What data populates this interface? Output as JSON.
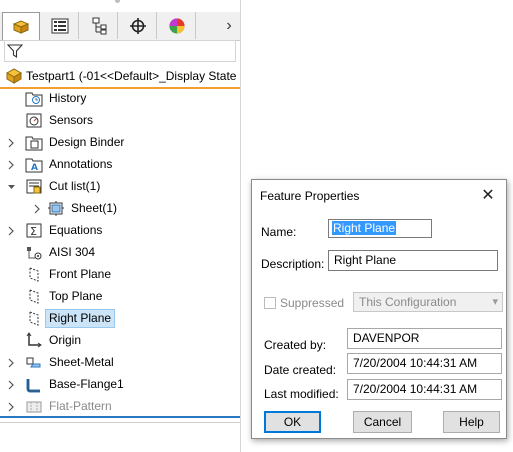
{
  "tree": {
    "root_label": "Testpart1  (-01<<Default>_Display State",
    "nodes": [
      {
        "label": "History",
        "icon": "history-folder-icon",
        "expandable": false
      },
      {
        "label": "Sensors",
        "icon": "sensors-icon",
        "expandable": false
      },
      {
        "label": "Design Binder",
        "icon": "design-binder-icon",
        "expandable": true
      },
      {
        "label": "Annotations",
        "icon": "annotations-icon",
        "expandable": true
      },
      {
        "label": "Cut list(1)",
        "icon": "cut-list-icon",
        "expandable": true,
        "expanded": true
      },
      {
        "label": "Sheet(1)",
        "icon": "sheet-body-icon",
        "expandable": true
      },
      {
        "label": "Equations",
        "icon": "equations-icon",
        "expandable": true
      },
      {
        "label": "AISI 304",
        "icon": "material-icon",
        "expandable": false
      },
      {
        "label": "Front Plane",
        "icon": "plane-icon",
        "expandable": false
      },
      {
        "label": "Top Plane",
        "icon": "plane-icon",
        "expandable": false
      },
      {
        "label": "Right Plane",
        "icon": "plane-icon",
        "expandable": false,
        "selected": true
      },
      {
        "label": "Origin",
        "icon": "origin-icon",
        "expandable": false
      },
      {
        "label": "Sheet-Metal",
        "icon": "sheet-metal-icon",
        "expandable": true
      },
      {
        "label": "Base-Flange1",
        "icon": "base-flange-icon",
        "expandable": true
      },
      {
        "label": "Flat-Pattern",
        "icon": "flat-pattern-icon",
        "expandable": true,
        "suppressed": true
      }
    ],
    "more_tabs_glyph": "›"
  },
  "dialog": {
    "title": "Feature Properties",
    "close_glyph": "✕",
    "name_label": "Name:",
    "name_value": "Right Plane",
    "description_label": "Description:",
    "description_value": "Right Plane",
    "suppressed_label": "Suppressed",
    "configuration_value": "This Configuration",
    "created_by_label": "Created by:",
    "created_by_value": "DAVENPOR",
    "date_created_label": "Date created:",
    "date_created_value": "7/20/2004 10:44:31 AM",
    "last_modified_label": "Last modified:",
    "last_modified_value": "7/20/2004 10:44:31 AM",
    "ok_label": "OK",
    "cancel_label": "Cancel",
    "help_label": "Help"
  },
  "colors": {
    "selection": "#cce4f7",
    "accent_orange": "#f0a030",
    "accent_blue": "#2a78c2",
    "text_selection": "#3399ff"
  }
}
